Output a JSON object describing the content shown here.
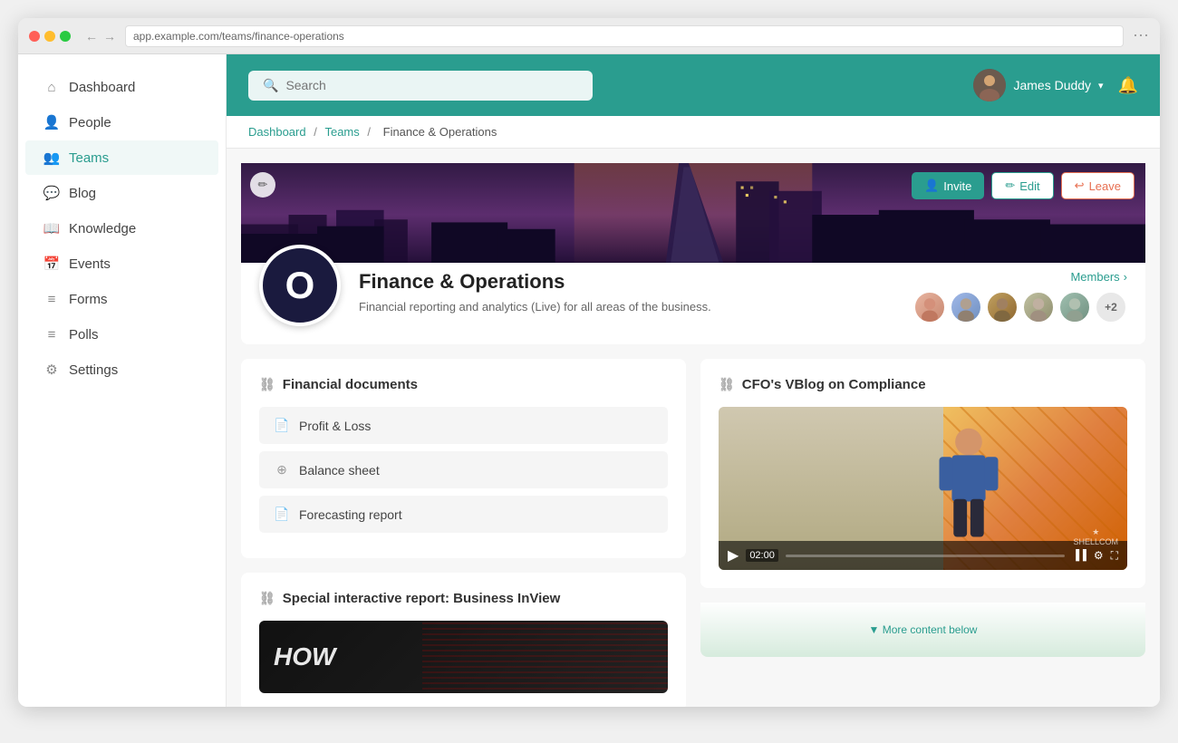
{
  "browser": {
    "url": "app.example.com/teams/finance-operations"
  },
  "header": {
    "search_placeholder": "Search",
    "user_name": "James Duddy",
    "chevron": "▾",
    "bell": "🔔"
  },
  "breadcrumb": {
    "dashboard": "Dashboard",
    "teams": "Teams",
    "current": "Finance & Operations"
  },
  "sidebar": {
    "items": [
      {
        "id": "dashboard",
        "label": "Dashboard",
        "icon": "⌂"
      },
      {
        "id": "people",
        "label": "People",
        "icon": "👤"
      },
      {
        "id": "teams",
        "label": "Teams",
        "icon": "👥"
      },
      {
        "id": "blog",
        "label": "Blog",
        "icon": "💬"
      },
      {
        "id": "knowledge",
        "label": "Knowledge",
        "icon": "📖"
      },
      {
        "id": "events",
        "label": "Events",
        "icon": "📅"
      },
      {
        "id": "forms",
        "label": "Forms",
        "icon": "≡"
      },
      {
        "id": "polls",
        "label": "Polls",
        "icon": "≡"
      },
      {
        "id": "settings",
        "label": "Settings",
        "icon": "⚙"
      }
    ]
  },
  "team": {
    "logo_letter": "O",
    "name": "Finance & Operations",
    "description": "Financial reporting and analytics (Live) for all areas of the business.",
    "members_label": "Members",
    "members_count_extra": "+2",
    "buttons": {
      "invite": "Invite",
      "edit": "Edit",
      "leave": "Leave"
    }
  },
  "financial_docs": {
    "section_title": "Financial documents",
    "items": [
      {
        "label": "Profit & Loss",
        "icon": "📄"
      },
      {
        "label": "Balance sheet",
        "icon": "⊕"
      },
      {
        "label": "Forecasting report",
        "icon": "📄"
      }
    ]
  },
  "vblog": {
    "section_title": "CFO's VBlog on Compliance",
    "video_time": "02:00",
    "watermark_line1": "★",
    "watermark_line2": "SHELLCOM"
  },
  "special_report": {
    "section_title": "Special interactive report: Business InView",
    "preview_text": "HOW"
  }
}
